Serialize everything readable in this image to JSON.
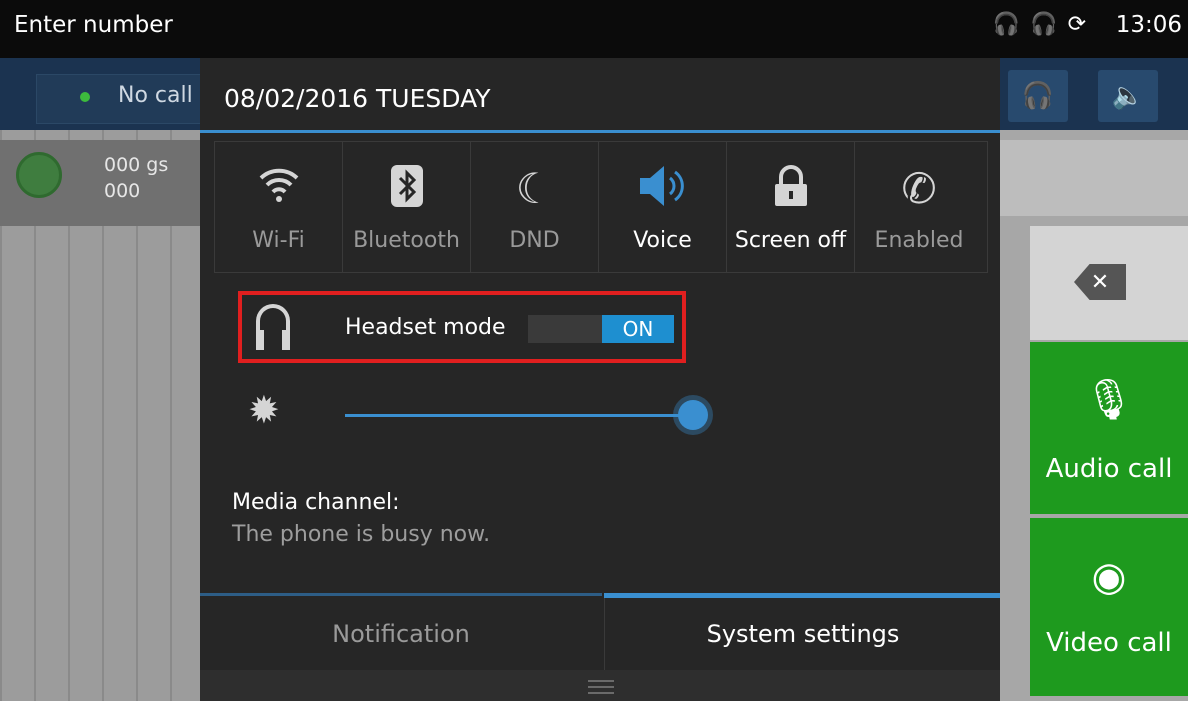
{
  "status_bar": {
    "title": "Enter number",
    "icons": [
      "headset-icon",
      "headset-audio-icon",
      "sync-icon"
    ],
    "time": "13:06"
  },
  "dialer": {
    "call_status": "No call",
    "contact_name": "000 gs",
    "contact_number": "000",
    "audio_call_label": "Audio call",
    "video_call_label": "Video call",
    "backspace_icon": "backspace-icon"
  },
  "panel": {
    "date": "08/02/2016 TUESDAY",
    "quick_settings": [
      {
        "label": "Wi-Fi",
        "icon": "wifi-icon",
        "active": false
      },
      {
        "label": "Bluetooth",
        "icon": "bluetooth-icon",
        "active": false
      },
      {
        "label": "DND",
        "icon": "moon-icon",
        "active": false
      },
      {
        "label": "Voice",
        "icon": "speaker-icon",
        "active": true
      },
      {
        "label": "Screen off",
        "icon": "lock-icon",
        "active": true
      },
      {
        "label": "Enabled",
        "icon": "call-forward-icon",
        "active": false
      }
    ],
    "headset_mode": {
      "label": "Headset mode",
      "state": "ON"
    },
    "brightness_level": 1.0,
    "media_channel": {
      "title": "Media channel:",
      "description": "The phone is busy now."
    },
    "tabs": [
      {
        "label": "Notification",
        "selected": false
      },
      {
        "label": "System settings",
        "selected": true
      }
    ]
  },
  "colors": {
    "accent": "#3a8fd0",
    "highlight_border": "#e01f1f",
    "call_green": "#1e9a1e",
    "panel_bg": "#262626"
  }
}
